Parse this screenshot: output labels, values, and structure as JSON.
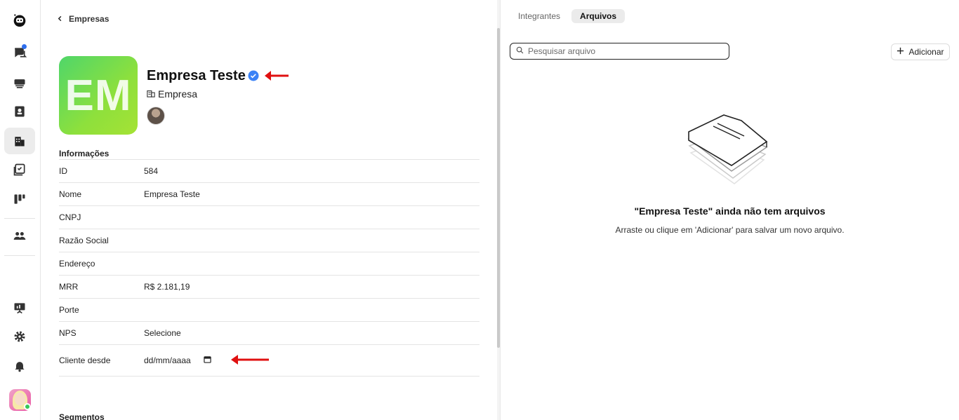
{
  "breadcrumb": {
    "back_label": "Empresas"
  },
  "company": {
    "initials": "EM",
    "name": "Empresa Teste",
    "type_label": "Empresa"
  },
  "info": {
    "section_label": "Informações",
    "rows": [
      {
        "key": "ID",
        "value": "584"
      },
      {
        "key": "Nome",
        "value": "Empresa Teste"
      },
      {
        "key": "CNPJ",
        "value": ""
      },
      {
        "key": "Razão Social",
        "value": ""
      },
      {
        "key": "Endereço",
        "value": ""
      },
      {
        "key": "MRR",
        "value": "R$ 2.181,19"
      },
      {
        "key": "Porte",
        "value": ""
      },
      {
        "key": "NPS",
        "value": "Selecione"
      },
      {
        "key": "Cliente desde",
        "value": "dd/mm/aaaa"
      }
    ]
  },
  "segments": {
    "section_label": "Segmentos"
  },
  "right": {
    "tabs": [
      {
        "label": "Integrantes",
        "active": false
      },
      {
        "label": "Arquivos",
        "active": true
      }
    ],
    "search_placeholder": "Pesquisar arquivo",
    "add_label": "Adicionar",
    "empty_title": "\"Empresa Teste\" ainda não tem arquivos",
    "empty_subtitle": "Arraste ou clique em 'Adicionar' para salvar um novo arquivo."
  },
  "colors": {
    "accent_blue": "#3b82f6",
    "annotation_red": "#e01010",
    "logo_gradient_start": "#4fd66a",
    "logo_gradient_end": "#a5e235"
  },
  "icons": {
    "rail": [
      "app-logo-icon",
      "chat-icon",
      "inbox-icon",
      "contacts-icon",
      "companies-icon",
      "tasks-icon",
      "kanban-icon",
      "team-icon",
      "presentation-icon",
      "settings-icon",
      "bell-icon"
    ]
  }
}
